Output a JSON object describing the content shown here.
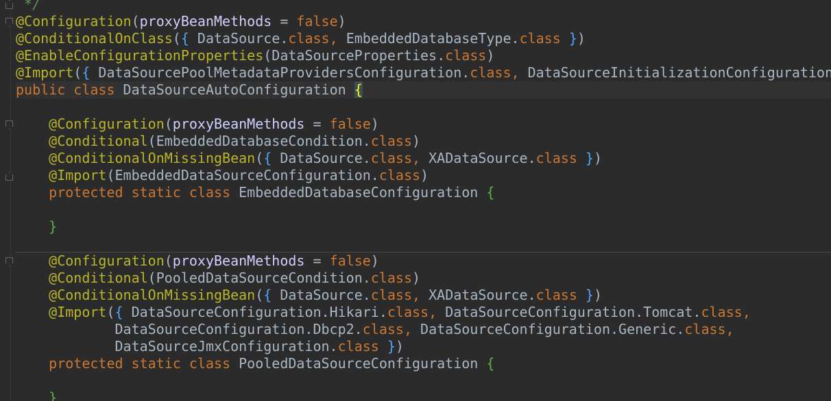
{
  "lines": [
    [
      [
        "cm",
        " */"
      ]
    ],
    [
      [
        "ann",
        "@Configuration"
      ],
      [
        "txt",
        "("
      ],
      [
        "param",
        "proxyBeanMethods"
      ],
      [
        "txt",
        " = "
      ],
      [
        "kw",
        "false"
      ],
      [
        "txt",
        ")"
      ]
    ],
    [
      [
        "ann",
        "@ConditionalOnClass"
      ],
      [
        "txt",
        "("
      ],
      [
        "br2",
        "{"
      ],
      [
        "txt",
        " DataSource."
      ],
      [
        "kw",
        "class"
      ],
      [
        "pun",
        ", "
      ],
      [
        "txt",
        "EmbeddedDatabaseType."
      ],
      [
        "kw",
        "class"
      ],
      [
        "txt",
        " "
      ],
      [
        "br2",
        "}"
      ],
      [
        "txt",
        ")"
      ]
    ],
    [
      [
        "ann",
        "@EnableConfigurationProperties"
      ],
      [
        "txt",
        "(DataSourceProperties."
      ],
      [
        "kw",
        "class"
      ],
      [
        "txt",
        ")"
      ]
    ],
    [
      [
        "ann",
        "@Import"
      ],
      [
        "txt",
        "("
      ],
      [
        "br2",
        "{"
      ],
      [
        "txt",
        " DataSourcePoolMetadataProvidersConfiguration."
      ],
      [
        "kw",
        "class"
      ],
      [
        "pun",
        ", "
      ],
      [
        "txt",
        "DataSourceInitializationConfiguration"
      ]
    ],
    [
      [
        "kw",
        "public class "
      ],
      [
        "txt",
        "DataSourceAutoConfiguration "
      ],
      [
        "hl",
        "{"
      ]
    ],
    [],
    [
      [
        "txt",
        "    "
      ],
      [
        "ann",
        "@Configuration"
      ],
      [
        "txt",
        "("
      ],
      [
        "param",
        "proxyBeanMethods"
      ],
      [
        "txt",
        " = "
      ],
      [
        "kw",
        "false"
      ],
      [
        "txt",
        ")"
      ]
    ],
    [
      [
        "txt",
        "    "
      ],
      [
        "ann",
        "@Conditional"
      ],
      [
        "txt",
        "(EmbeddedDatabaseCondition."
      ],
      [
        "kw",
        "class"
      ],
      [
        "txt",
        ")"
      ]
    ],
    [
      [
        "txt",
        "    "
      ],
      [
        "ann",
        "@ConditionalOnMissingBean"
      ],
      [
        "txt",
        "("
      ],
      [
        "br2",
        "{"
      ],
      [
        "txt",
        " DataSource."
      ],
      [
        "kw",
        "class"
      ],
      [
        "pun",
        ", "
      ],
      [
        "txt",
        "XADataSource."
      ],
      [
        "kw",
        "class"
      ],
      [
        "txt",
        " "
      ],
      [
        "br2",
        "}"
      ],
      [
        "txt",
        ")"
      ]
    ],
    [
      [
        "txt",
        "    "
      ],
      [
        "ann",
        "@Import"
      ],
      [
        "txt",
        "(EmbeddedDataSourceConfiguration."
      ],
      [
        "kw",
        "class"
      ],
      [
        "txt",
        ")"
      ]
    ],
    [
      [
        "txt",
        "    "
      ],
      [
        "kw",
        "protected static class "
      ],
      [
        "txt",
        "EmbeddedDatabaseConfiguration "
      ],
      [
        "br3",
        "{"
      ]
    ],
    [],
    [
      [
        "txt",
        "    "
      ],
      [
        "br3",
        "}"
      ]
    ],
    [],
    [
      [
        "txt",
        "    "
      ],
      [
        "ann",
        "@Configuration"
      ],
      [
        "txt",
        "("
      ],
      [
        "param",
        "proxyBeanMethods"
      ],
      [
        "txt",
        " = "
      ],
      [
        "kw",
        "false"
      ],
      [
        "txt",
        ")"
      ]
    ],
    [
      [
        "txt",
        "    "
      ],
      [
        "ann",
        "@Conditional"
      ],
      [
        "txt",
        "(PooledDataSourceCondition."
      ],
      [
        "kw",
        "class"
      ],
      [
        "txt",
        ")"
      ]
    ],
    [
      [
        "txt",
        "    "
      ],
      [
        "ann",
        "@ConditionalOnMissingBean"
      ],
      [
        "txt",
        "("
      ],
      [
        "br2",
        "{"
      ],
      [
        "txt",
        " DataSource."
      ],
      [
        "kw",
        "class"
      ],
      [
        "pun",
        ", "
      ],
      [
        "txt",
        "XADataSource."
      ],
      [
        "kw",
        "class"
      ],
      [
        "txt",
        " "
      ],
      [
        "br2",
        "}"
      ],
      [
        "txt",
        ")"
      ]
    ],
    [
      [
        "txt",
        "    "
      ],
      [
        "ann",
        "@Import"
      ],
      [
        "txt",
        "("
      ],
      [
        "br2",
        "{"
      ],
      [
        "txt",
        " DataSourceConfiguration.Hikari."
      ],
      [
        "kw",
        "class"
      ],
      [
        "pun",
        ", "
      ],
      [
        "txt",
        "DataSourceConfiguration.Tomcat."
      ],
      [
        "kw",
        "class"
      ],
      [
        "pun",
        ","
      ]
    ],
    [
      [
        "txt",
        "            DataSourceConfiguration.Dbcp2."
      ],
      [
        "kw",
        "class"
      ],
      [
        "pun",
        ", "
      ],
      [
        "txt",
        "DataSourceConfiguration.Generic."
      ],
      [
        "kw",
        "class"
      ],
      [
        "pun",
        ","
      ]
    ],
    [
      [
        "txt",
        "            DataSourceJmxConfiguration."
      ],
      [
        "kw",
        "class"
      ],
      [
        "txt",
        " "
      ],
      [
        "br2",
        "}"
      ],
      [
        "txt",
        ")"
      ]
    ],
    [
      [
        "txt",
        "    "
      ],
      [
        "kw",
        "protected static class "
      ],
      [
        "txt",
        "PooledDataSourceConfiguration "
      ],
      [
        "br3",
        "{"
      ]
    ],
    [],
    [
      [
        "txt",
        "    "
      ],
      [
        "br3",
        "}"
      ]
    ]
  ],
  "colors": {
    "background": "#2b2b2b",
    "annotation": "#bbb529",
    "keyword": "#cc7832",
    "parameter": "#d0d0ff",
    "text": "#a9b7c6",
    "comment": "#629755"
  },
  "gutter_icons": [
    "fold-open-icon",
    "fold-close-icon"
  ]
}
